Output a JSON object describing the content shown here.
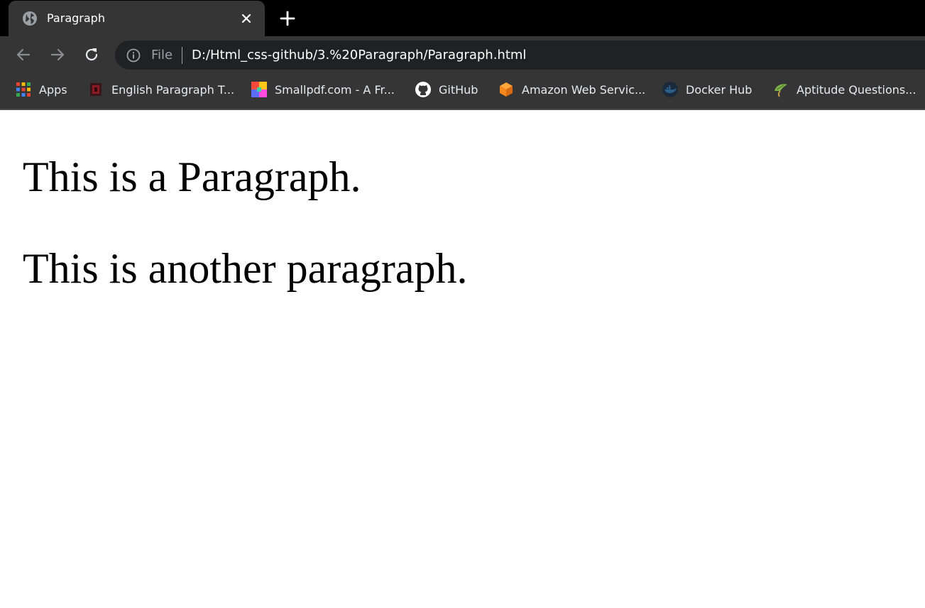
{
  "tab": {
    "title": "Paragraph"
  },
  "address_bar": {
    "scheme_label": "File",
    "url": "D:/Html_css-github/3.%20Paragraph/Paragraph.html"
  },
  "bookmarks": [
    {
      "label": "Apps",
      "icon": "apps-grid-icon"
    },
    {
      "label": "English Paragraph T...",
      "icon": "english-paragraph-favicon"
    },
    {
      "label": "Smallpdf.com - A Fr...",
      "icon": "smallpdf-favicon"
    },
    {
      "label": "GitHub",
      "icon": "github-icon"
    },
    {
      "label": "Amazon Web Servic...",
      "icon": "aws-cube-icon"
    },
    {
      "label": "Docker Hub",
      "icon": "docker-icon"
    },
    {
      "label": "Aptitude Questions...",
      "icon": "aptitude-favicon"
    }
  ],
  "page": {
    "paragraphs": [
      "This is a Paragraph.",
      "This is another paragraph."
    ]
  },
  "colors": {
    "tabstrip_bg": "#000000",
    "toolbar_bg": "#353535",
    "omnibox_bg": "#202124",
    "text_light": "#e8eaed",
    "page_bg": "#ffffff"
  }
}
